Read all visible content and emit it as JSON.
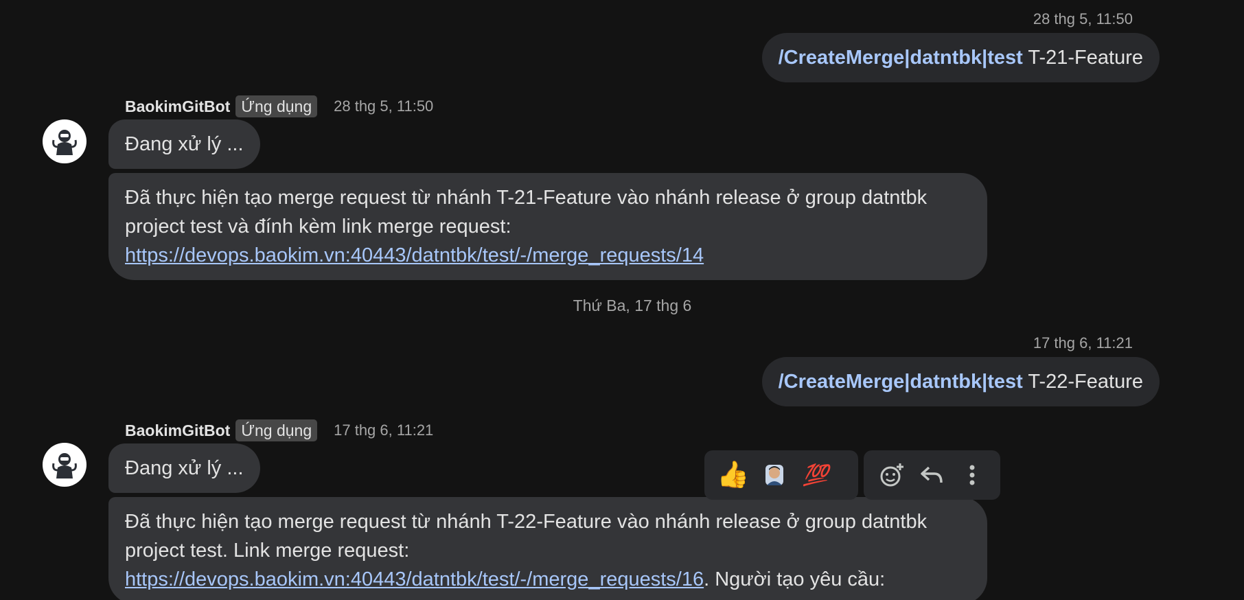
{
  "messages": {
    "m1": {
      "timestamp": "28 thg 5, 11:50",
      "command": "/CreateMerge|datntbk|test",
      "arg": " T-21-Feature"
    },
    "m2": {
      "sender": "BaokimGitBot",
      "badge": "Ứng dụng",
      "timestamp": "28 thg 5, 11:50",
      "status": "Đang xử lý ...",
      "text": "Đã thực hiện tạo merge request từ nhánh T-21-Feature vào nhánh release ở group datntbk project test và đính kèm link merge request:",
      "link": "https://devops.baokim.vn:40443/datntbk/test/-/merge_requests/14"
    },
    "date_divider": "Thứ Ba, 17 thg 6",
    "m3": {
      "timestamp": "17 thg 6, 11:21",
      "command": "/CreateMerge|datntbk|test",
      "arg": " T-22-Feature"
    },
    "m4": {
      "sender": "BaokimGitBot",
      "badge": "Ứng dụng",
      "timestamp": "17 thg 6, 11:21",
      "status": "Đang xử lý ...",
      "text": "Đã thực hiện tạo merge request từ nhánh T-22-Feature vào nhánh release ở group datntbk project test. Link merge request:",
      "link": "https://devops.baokim.vn:40443/datntbk/test/-/merge_requests/16",
      "suffix": ". Người tạo yêu cầu:"
    }
  },
  "toolbar": {
    "reactions": [
      "👍",
      "💯"
    ],
    "icons": [
      "thumbs-up-emoji",
      "person-emoji",
      "hundred-points-emoji",
      "add-reaction-icon",
      "reply-icon",
      "more-vert-icon"
    ]
  },
  "colors": {
    "background": "#131313",
    "bubble_outgoing": "#28292c",
    "bubble_incoming": "#343538",
    "link": "#a8c7fa"
  }
}
